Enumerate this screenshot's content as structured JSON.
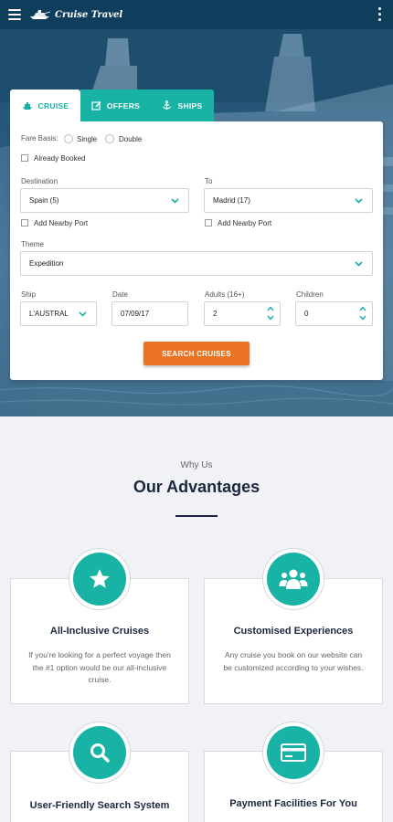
{
  "header": {
    "brand": "Cruise Travel",
    "menu_icon": "hamburger-menu-icon",
    "more_icon": "kebab-menu-icon"
  },
  "tabs": [
    {
      "label": "CRUISE",
      "icon": "ship-icon",
      "active": true
    },
    {
      "label": "OFFERS",
      "icon": "edit-icon",
      "active": false
    },
    {
      "label": "SHIPS",
      "icon": "anchor-icon",
      "active": false
    }
  ],
  "search": {
    "fare_basis_label": "Fare Basis:",
    "fare_options": [
      "Single",
      "Double"
    ],
    "already_booked_label": "Already Booked",
    "destination_label": "Destination",
    "destination_value": "Spain (5)",
    "to_label": "To",
    "to_value": "Madrid (17)",
    "nearby_port_label": "Add Nearby Port",
    "theme_label": "Theme",
    "theme_value": "Expedition",
    "ship_label": "Ship",
    "ship_value": "L'AUSTRAL",
    "date_label": "Date",
    "date_value": "07/09/17",
    "adults_label": "Adults (16+)",
    "adults_value": "2",
    "children_label": "Children",
    "children_value": "0",
    "submit_label": "SEARCH CRUISES"
  },
  "advantages": {
    "eyebrow": "Why Us",
    "title": "Our Advantages",
    "cards": [
      {
        "title": "All-Inclusive Cruises",
        "description": "If you're looking for a perfect voyage then the #1 option would be our all-inclusive cruise.",
        "icon": "star-icon"
      },
      {
        "title": "Customised Experiences",
        "description": "Any cruise you book on our website can be customized according to your wishes.",
        "icon": "group-icon"
      },
      {
        "title": "User-Friendly Search System",
        "description": "",
        "icon": "search-icon"
      },
      {
        "title": "Payment Facilities For You",
        "description": "",
        "icon": "credit-card-icon"
      }
    ]
  },
  "colors": {
    "header": "#0e3e5c",
    "accent": "#19b3a5",
    "button": "#ea7423",
    "heading": "#1b2740",
    "background": "#f1f2f6"
  }
}
